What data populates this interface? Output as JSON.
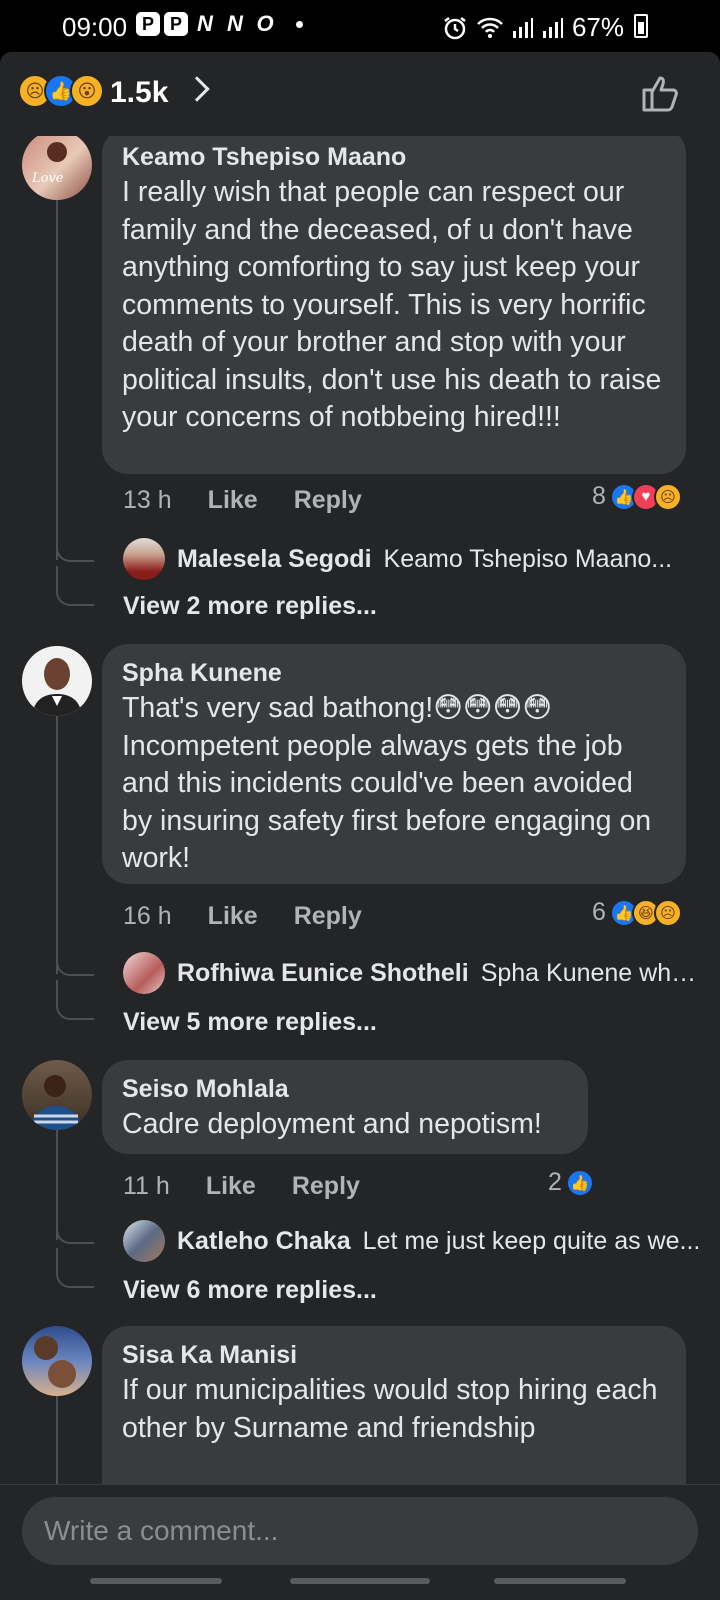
{
  "status_bar": {
    "time": "09:00",
    "notif_icons": [
      "P",
      "P",
      "N",
      "N",
      "O"
    ],
    "battery": "67%"
  },
  "reactions_summary": {
    "count": "1.5k",
    "emojis": [
      "sad",
      "like",
      "wow"
    ]
  },
  "comments": [
    {
      "author": "Keamo Tshepiso Maano",
      "text": "I really wish that people can respect our family and the deceased, of u don't have anything comforting to say just keep your comments to yourself. This is  very horrific death of your brother and stop with your political insults, don't use his death to raise your concerns of notbbeing hired!!!",
      "time": "13 h",
      "like": "Like",
      "reply": "Reply",
      "reaction_count": "8",
      "reactions": [
        "like",
        "love",
        "sad"
      ],
      "reply_author": "Malesela Segodi",
      "reply_text": "Keamo Tshepiso Maano...",
      "more_replies": "View 2 more replies..."
    },
    {
      "author": "Spha Kunene",
      "text": "That's very sad bathong!😳😳😳😳 Incompetent people always gets the job and this incidents could've been avoided by insuring safety first before engaging on work!",
      "time": "16 h",
      "like": "Like",
      "reply": "Reply",
      "reaction_count": "6",
      "reactions": [
        "like",
        "haha",
        "sad"
      ],
      "reply_author": "Rofhiwa Eunice Shotheli",
      "reply_text": "Spha Kunene wha...",
      "more_replies": "View 5 more replies..."
    },
    {
      "author": "Seiso Mohlala",
      "text": "Cadre deployment and nepotism!",
      "time": "11 h",
      "like": "Like",
      "reply": "Reply",
      "reaction_count": "2",
      "reactions": [
        "like"
      ],
      "reply_author": "Katleho Chaka",
      "reply_text": "Let me just keep quite as we...",
      "more_replies": "View 6 more replies..."
    },
    {
      "author": "Sisa Ka Manisi",
      "text": "If our municipalities would stop hiring each other by Surname and friendship"
    }
  ],
  "composer": {
    "placeholder": "Write a comment..."
  },
  "colors": {
    "background": "#242526",
    "bubble": "#3a3b3c",
    "like_blue": "#1877f2",
    "love_red": "#f33e58",
    "emoji_yellow": "#f7b125"
  }
}
